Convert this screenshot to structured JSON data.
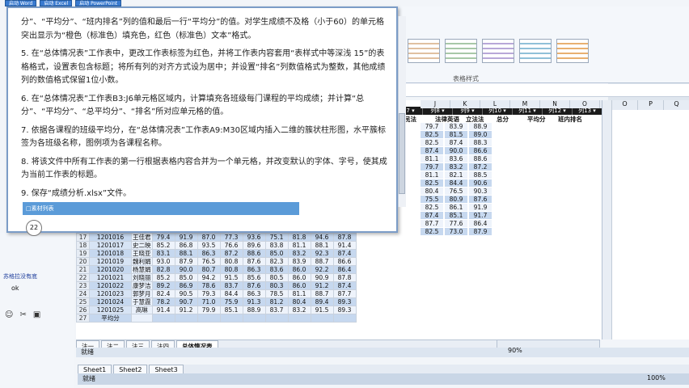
{
  "taskbar": {
    "buttons": [
      "启动 Word",
      "启动 Excel",
      "启动 PowerPoint"
    ]
  },
  "dialog": {
    "paragraphs": [
      "分”、“平均分”、“班内排名”列的值和最后一行“平均分”的值。对学生成绩不及格（小于60）的单元格突出显示为“橙色（标准色）填充色，红色（标准色）文本”格式。",
      "5. 在“总体情况表”工作表中，更改工作表标签为红色，并将工作表内容套用“表样式中等深浅 15”的表格格式，设置表包含标题；将所有列的对齐方式设为居中；并设置“排名”列数值格式为整数，其他成绩列的数值格式保留1位小数。",
      "6. 在“总体情况表”工作表B3:J6单元格区域内，计算填充各班级每门课程的平均成绩；并计算“总分”、“平均分”、“总平均分”、“排名”所对应单元格的值。",
      "7. 依据各课程的班级平均分，在“总体情况表”工作表A9:M30区域内插入二维的簇状柱形图，水平簇标签为各班级名称，图例项为各课程名称。",
      "8. 将该文件中所有工作表的第一行根据表格内容合并为一个单元格，并改变默认的字体、字号，使其成为当前工作表的标题。",
      "9. 保存“成绩分析.xlsx”文件。"
    ],
    "material_bar": "□素材列表",
    "page_number": "22"
  },
  "ribbon": {
    "group_label": "表格样式"
  },
  "columns": {
    "letters": [
      "J",
      "K",
      "L",
      "M",
      "N",
      "O",
      "P",
      "Q"
    ]
  },
  "table_headers": [
    "列7",
    "列8",
    "列9",
    "列10",
    "列11",
    "列12",
    "列13"
  ],
  "header_labels": [
    "民法",
    "法律英语",
    "立法法",
    "总分",
    "平均分",
    "班内排名"
  ],
  "rows": [
    {
      "r": "16",
      "id": "1201015",
      "name": "盛雅",
      "v": [
        "87.6",
        "90.6",
        "82.1",
        "87.2",
        "92.6",
        "84.1",
        "83.2",
        "88.6",
        "90.7"
      ]
    },
    {
      "r": "17",
      "id": "1201016",
      "name": "王佳君",
      "v": [
        "79.4",
        "91.9",
        "87.0",
        "77.3",
        "93.6",
        "75.1",
        "81.8",
        "94.6",
        "87.8"
      ]
    },
    {
      "r": "18",
      "id": "1201017",
      "name": "史二映",
      "v": [
        "85.2",
        "86.8",
        "93.5",
        "76.6",
        "89.6",
        "83.8",
        "81.1",
        "88.1",
        "91.4"
      ]
    },
    {
      "r": "19",
      "id": "1201018",
      "name": "王晓亚",
      "v": [
        "83.1",
        "88.1",
        "86.3",
        "87.2",
        "88.6",
        "85.0",
        "83.2",
        "92.3",
        "87.4"
      ]
    },
    {
      "r": "20",
      "id": "1201019",
      "name": "魏利娟",
      "v": [
        "93.0",
        "87.9",
        "76.5",
        "80.8",
        "87.6",
        "82.3",
        "83.9",
        "88.7",
        "86.6"
      ]
    },
    {
      "r": "21",
      "id": "1201020",
      "name": "杨慧娟",
      "v": [
        "82.8",
        "90.0",
        "80.7",
        "80.8",
        "86.3",
        "83.6",
        "86.0",
        "92.2",
        "86.4"
      ]
    },
    {
      "r": "22",
      "id": "1201021",
      "name": "刘晓丽",
      "v": [
        "85.2",
        "85.0",
        "94.2",
        "91.5",
        "85.6",
        "80.5",
        "86.0",
        "90.9",
        "87.8"
      ]
    },
    {
      "r": "23",
      "id": "1201022",
      "name": "康梦洁",
      "v": [
        "89.2",
        "86.9",
        "78.6",
        "83.7",
        "87.6",
        "80.3",
        "86.0",
        "91.2",
        "87.4"
      ]
    },
    {
      "r": "24",
      "id": "1201023",
      "name": "郭梦月",
      "v": [
        "82.4",
        "90.5",
        "79.3",
        "84.4",
        "86.3",
        "78.5",
        "81.1",
        "88.7",
        "87.7"
      ]
    },
    {
      "r": "25",
      "id": "1201024",
      "name": "于慧霞",
      "v": [
        "78.2",
        "90.7",
        "71.0",
        "75.9",
        "91.3",
        "81.2",
        "80.4",
        "89.4",
        "89.3"
      ]
    },
    {
      "r": "26",
      "id": "1201025",
      "name": "高琳",
      "v": [
        "91.4",
        "91.2",
        "79.9",
        "85.1",
        "88.9",
        "83.7",
        "83.2",
        "91.5",
        "89.3"
      ]
    },
    {
      "r": "27",
      "id": "平均分",
      "name": "",
      "v": [
        "",
        "",
        "",
        "",
        "",
        "",
        "",
        "",
        ""
      ]
    }
  ],
  "right_values": [
    [
      "79.7",
      "83.9",
      "88.9"
    ],
    [
      "82.5",
      "81.5",
      "89.0"
    ],
    [
      "82.5",
      "87.4",
      "88.3"
    ],
    [
      "87.4",
      "90.0",
      "86.6"
    ],
    [
      "81.1",
      "83.6",
      "88.6"
    ],
    [
      "79.7",
      "83.2",
      "87.2"
    ],
    [
      "81.1",
      "82.1",
      "88.5"
    ],
    [
      "82.5",
      "84.4",
      "90.6"
    ],
    [
      "80.4",
      "76.5",
      "90.3"
    ],
    [
      "75.5",
      "80.9",
      "87.6"
    ],
    [
      "82.5",
      "86.1",
      "91.9"
    ],
    [
      "87.4",
      "85.1",
      "91.7"
    ],
    [
      "87.7",
      "77.6",
      "86.4"
    ],
    [
      "82.5",
      "73.0",
      "87.9"
    ]
  ],
  "sheet_tabs": [
    "法一",
    "法二",
    "法三",
    "法四",
    "总体情况表"
  ],
  "status1": {
    "ready": "就绪",
    "zoom": "90%"
  },
  "sheet_tabs2": [
    "Sheet1",
    "Sheet2",
    "Sheet3"
  ],
  "status2": {
    "ready": "就绪",
    "zoom": "100%"
  },
  "left_panel": {
    "link": "苏格拉没有底",
    "ok": "ok"
  },
  "outer_cols": [
    "O",
    "P",
    "Q"
  ]
}
